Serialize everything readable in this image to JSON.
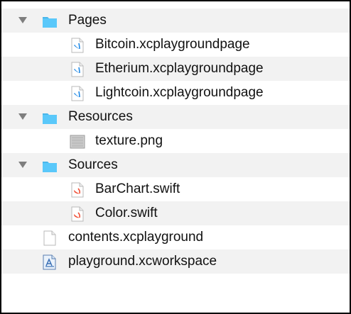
{
  "colors": {
    "folder": "#5ac8fa",
    "folder_tab": "#49b6ea",
    "disclosure": "#7e7e7e",
    "stripe": "#f2f2f2",
    "swift": "#f05138",
    "playground_page": "#1e88e5"
  },
  "tree": {
    "pages": {
      "label": "Pages",
      "icon": "folder-icon",
      "children": [
        {
          "label": "Bitcoin.xcplaygroundpage",
          "icon": "playground-page-icon"
        },
        {
          "label": "Etherium.xcplaygroundpage",
          "icon": "playground-page-icon"
        },
        {
          "label": "Lightcoin.xcplaygroundpage",
          "icon": "playground-page-icon"
        }
      ]
    },
    "resources": {
      "label": "Resources",
      "icon": "folder-icon",
      "children": [
        {
          "label": "texture.png",
          "icon": "image-file-icon"
        }
      ]
    },
    "sources": {
      "label": "Sources",
      "icon": "folder-icon",
      "children": [
        {
          "label": "BarChart.swift",
          "icon": "swift-file-icon"
        },
        {
          "label": "Color.swift",
          "icon": "swift-file-icon"
        }
      ]
    },
    "files": [
      {
        "label": "contents.xcplayground",
        "icon": "document-icon"
      },
      {
        "label": "playground.xcworkspace",
        "icon": "workspace-icon"
      }
    ]
  }
}
